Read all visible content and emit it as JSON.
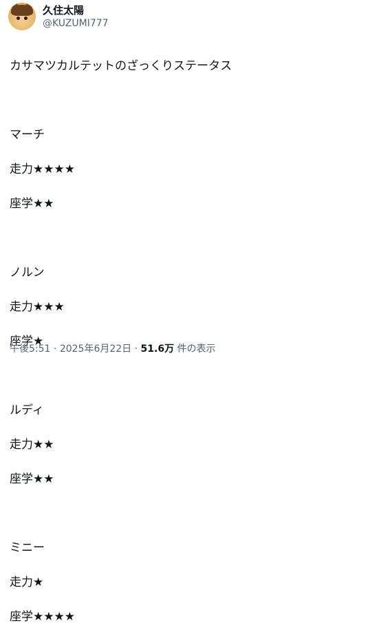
{
  "author": {
    "display_name": "久住太陽",
    "handle": "@KUZUMI777",
    "avatar_icon": "horse-girl-avatar"
  },
  "post": {
    "lines": [
      "カサマツカルテットのざっくりステータス",
      "",
      "マーチ",
      "走力★★★★",
      "座学★★",
      "",
      "ノルン",
      "走力★★★",
      "座学★",
      "",
      "ルディ",
      "走力★★",
      "座学★★",
      "",
      "ミニー",
      "走力★",
      "座学★★★★"
    ]
  },
  "meta": {
    "time": "午後5:51",
    "sep1": " · ",
    "date": "2025年6月22日",
    "sep2": " · ",
    "views_count": "51.6万",
    "views_label": " 件の表示"
  }
}
